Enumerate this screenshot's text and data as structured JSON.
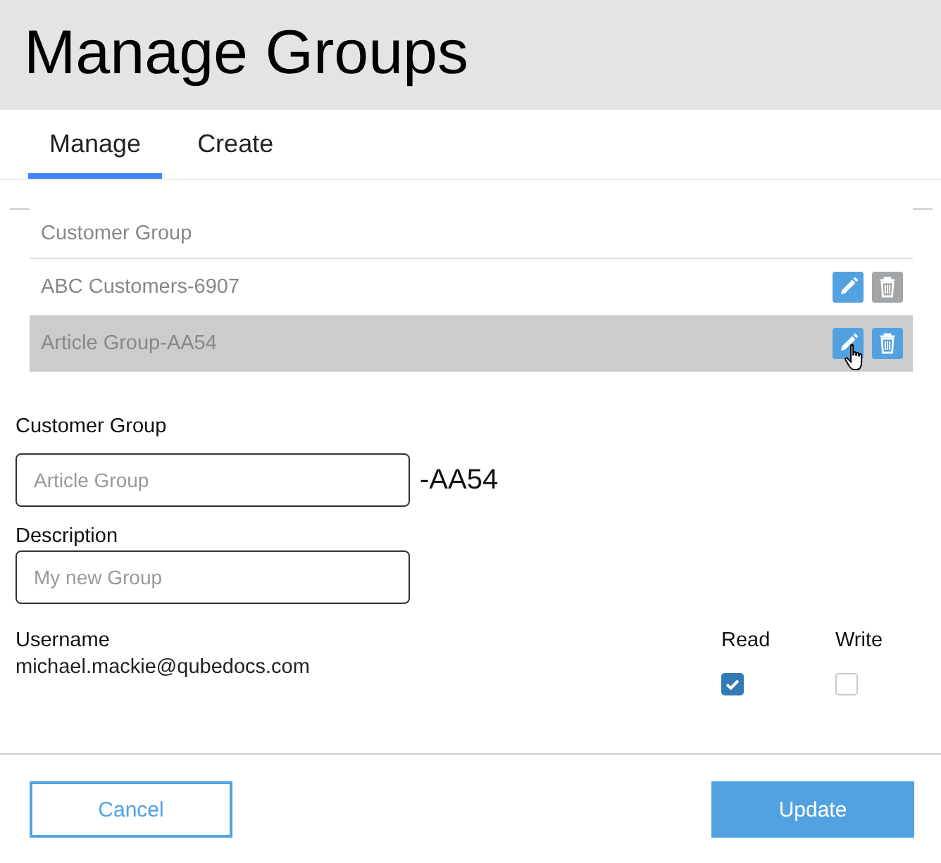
{
  "header": {
    "title": "Manage Groups"
  },
  "tabs": [
    {
      "label": "Manage",
      "selected": true
    },
    {
      "label": "Create",
      "selected": false
    }
  ],
  "groups_table": {
    "columns": [
      "Customer Group"
    ],
    "rows": [
      {
        "name": "ABC Customers-6907",
        "selected": false,
        "delete_disabled": true
      },
      {
        "name": "Article Group-AA54",
        "selected": true,
        "delete_disabled": false
      }
    ]
  },
  "form": {
    "group_label": "Customer Group",
    "group_field": {
      "placeholder": "Article Group"
    },
    "suffix": "-AA54",
    "description_label": "Description",
    "description_field": {
      "placeholder": "My new Group"
    }
  },
  "permissions": {
    "columns": [
      "Username",
      "Read",
      "Write"
    ],
    "rows": [
      {
        "username": "michael.mackie@qubedocs.com",
        "read": true,
        "write": false
      }
    ]
  },
  "buttons": [
    {
      "label": "Cancel",
      "kind": "secondary"
    },
    {
      "label": "Update",
      "kind": "primary"
    }
  ]
}
